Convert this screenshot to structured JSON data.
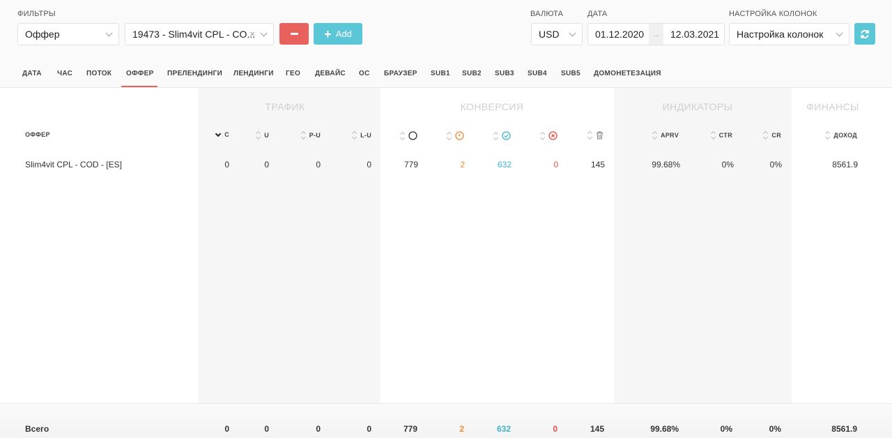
{
  "filters": {
    "label": "ФИЛЬТРЫ",
    "type_value": "Оффер",
    "offer_value": "19473 - Slim4vit CPL - CO...",
    "clear_icon": "x-icon",
    "add_label": "Add"
  },
  "currency": {
    "label": "ВАЛЮТА",
    "value": "USD"
  },
  "date": {
    "label": "ДАТА",
    "from": "01.12.2020",
    "to": "12.03.2021",
    "arrow": "→"
  },
  "columns_setting": {
    "label": "НАСТРОЙКА КОЛОНОК",
    "value": "Настройка колонок"
  },
  "tabs": [
    {
      "label": "ДАТА"
    },
    {
      "label": "ЧАС"
    },
    {
      "label": "ПОТОК"
    },
    {
      "label": "ОФФЕР"
    },
    {
      "label": "ПРЕЛЕНДИНГИ"
    },
    {
      "label": "ЛЕНДИНГИ"
    },
    {
      "label": "ГЕО"
    },
    {
      "label": "ДЕВАЙС"
    },
    {
      "label": "ОС"
    },
    {
      "label": "БРАУЗЕР"
    },
    {
      "label": "SUB1"
    },
    {
      "label": "SUB2"
    },
    {
      "label": "SUB3"
    },
    {
      "label": "SUB4"
    },
    {
      "label": "SUB5"
    },
    {
      "label": "ДОМОНЕТЕЗАЦИЯ"
    }
  ],
  "active_tab": "ОФФЕР",
  "groups": {
    "traffic": "ТРАФИК",
    "conversion": "КОНВЕРСИЯ",
    "indicators": "ИНДИКАТОРЫ",
    "finance": "ФИНАНСЫ"
  },
  "headers": {
    "offer": "ОФФЕР",
    "c": "C",
    "u": "U",
    "pu": "P-U",
    "lu": "L-U",
    "aprv": "APRV",
    "ctr": "CTR",
    "cr": "CR",
    "income": "ДОХОД"
  },
  "rows": [
    {
      "name": "Slim4vit CPL - COD - [ES]",
      "c": "0",
      "u": "0",
      "pu": "0",
      "lu": "0",
      "total": "779",
      "hold": "2",
      "approved": "632",
      "rejected": "0",
      "trash": "145",
      "aprv": "99.68%",
      "ctr": "0%",
      "cr": "0%",
      "income": "8561.9"
    }
  ],
  "totals": {
    "label": "Всего",
    "c": "0",
    "u": "0",
    "pu": "0",
    "lu": "0",
    "total": "779",
    "hold": "2",
    "approved": "632",
    "rejected": "0",
    "trash": "145",
    "aprv": "99.68%",
    "ctr": "0%",
    "cr": "0%",
    "income": "8561.9"
  },
  "colors": {
    "accent_red": "#e8615d",
    "accent_teal": "#5bc6d6",
    "hold_orange": "#ef8a3a",
    "approved_teal": "#3fb5cc",
    "rejected_red": "#e8504b"
  }
}
